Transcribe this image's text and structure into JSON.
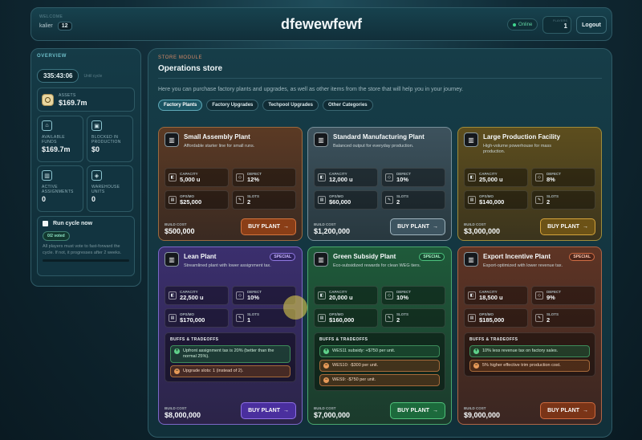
{
  "header": {
    "user_caption": "WELCOME",
    "username": "kalier",
    "user_level": "12",
    "title": "dfewewfewf",
    "status": "Online",
    "level_caption": "PLAYERS",
    "level_value": "1",
    "logout": "Logout"
  },
  "sidebar": {
    "heading": "OVERVIEW",
    "timer": "335:43:06",
    "timer_caption": "Until cycle",
    "assets": {
      "label": "ASSETS",
      "value": "$169.7m"
    },
    "tiles": [
      {
        "label": "AVAILABLE FUNDS",
        "value": "$169.7m",
        "icon": "bank-icon"
      },
      {
        "label": "BLOCKED IN PRODUCTION",
        "value": "$0",
        "icon": "lock-icon"
      },
      {
        "label": "ACTIVE ASSIGNMENTS",
        "value": "0",
        "icon": "factory-icon"
      },
      {
        "label": "WAREHOUSE UNITS",
        "value": "0",
        "icon": "box-icon"
      }
    ],
    "cycle": {
      "label": "Run cycle now",
      "voted": "0/2 voted",
      "desc": "All players must vote to fast-forward the cycle. If not, it progresses after 2 weeks."
    }
  },
  "store": {
    "eyebrow": "STORE MODULE",
    "title": "Operations store",
    "intro": "Here you can purchase factory plants and upgrades, as well as other items from the store that will help you in your journey.",
    "tabs": [
      "Factory Plants",
      "Factory Upgrades",
      "Techpool Upgrades",
      "Other Categories"
    ],
    "labels": {
      "capacity": "CAPACITY",
      "defect": "DEFECT",
      "ops": "OPS/MO",
      "slots": "SLOTS",
      "build_cost": "BUILD COST",
      "buy": "BUY PLANT",
      "buy_arrow": "→",
      "buffs": "BUFFS & TRADEOFFS",
      "special": "SPECIAL"
    },
    "cards": [
      {
        "name": "Small Assembly Plant",
        "desc": "Affordable starter line for small runs.",
        "capacity": "5,000 u",
        "defect": "12%",
        "ops": "$25,000",
        "slots": "2",
        "cost": "$500,000"
      },
      {
        "name": "Standard Manufacturing Plant",
        "desc": "Balanced output for everyday production.",
        "capacity": "12,000 u",
        "defect": "10%",
        "ops": "$60,000",
        "slots": "2",
        "cost": "$1,200,000"
      },
      {
        "name": "Large Production Facility",
        "desc": "High-volume powerhouse for mass production.",
        "capacity": "25,000 u",
        "defect": "8%",
        "ops": "$140,000",
        "slots": "2",
        "cost": "$3,000,000"
      },
      {
        "name": "Lean Plant",
        "desc": "Streamlined plant with lower assignment tax.",
        "capacity": "22,500 u",
        "defect": "10%",
        "ops": "$170,000",
        "slots": "1",
        "cost": "$8,000,000",
        "buffs": [
          {
            "text": "Upfront assignment tax is 20% (better than the normal 25%).",
            "type": "up"
          },
          {
            "text": "Upgrade slots: 1 (instead of 2).",
            "type": "down"
          }
        ]
      },
      {
        "name": "Green Subsidy Plant",
        "desc": "Eco-subsidized rewards for clean WEG tiers.",
        "capacity": "20,000 u",
        "defect": "10%",
        "ops": "$160,000",
        "slots": "2",
        "cost": "$7,000,000",
        "buffs": [
          {
            "text": "WES11 subsidy: +$750 per unit.",
            "type": "up"
          },
          {
            "text": "WES10: -$300 per unit.",
            "type": "down"
          },
          {
            "text": "WES9: -$750 per unit.",
            "type": "down"
          }
        ]
      },
      {
        "name": "Export Incentive Plant",
        "desc": "Export-optimized with lower revenue tax.",
        "capacity": "18,500 u",
        "defect": "9%",
        "ops": "$185,000",
        "slots": "2",
        "cost": "$9,000,000",
        "buffs": [
          {
            "text": "10% less revenue tax on factory sales.",
            "type": "up"
          },
          {
            "text": "5% higher effective trim production cost.",
            "type": "down"
          }
        ]
      }
    ]
  }
}
